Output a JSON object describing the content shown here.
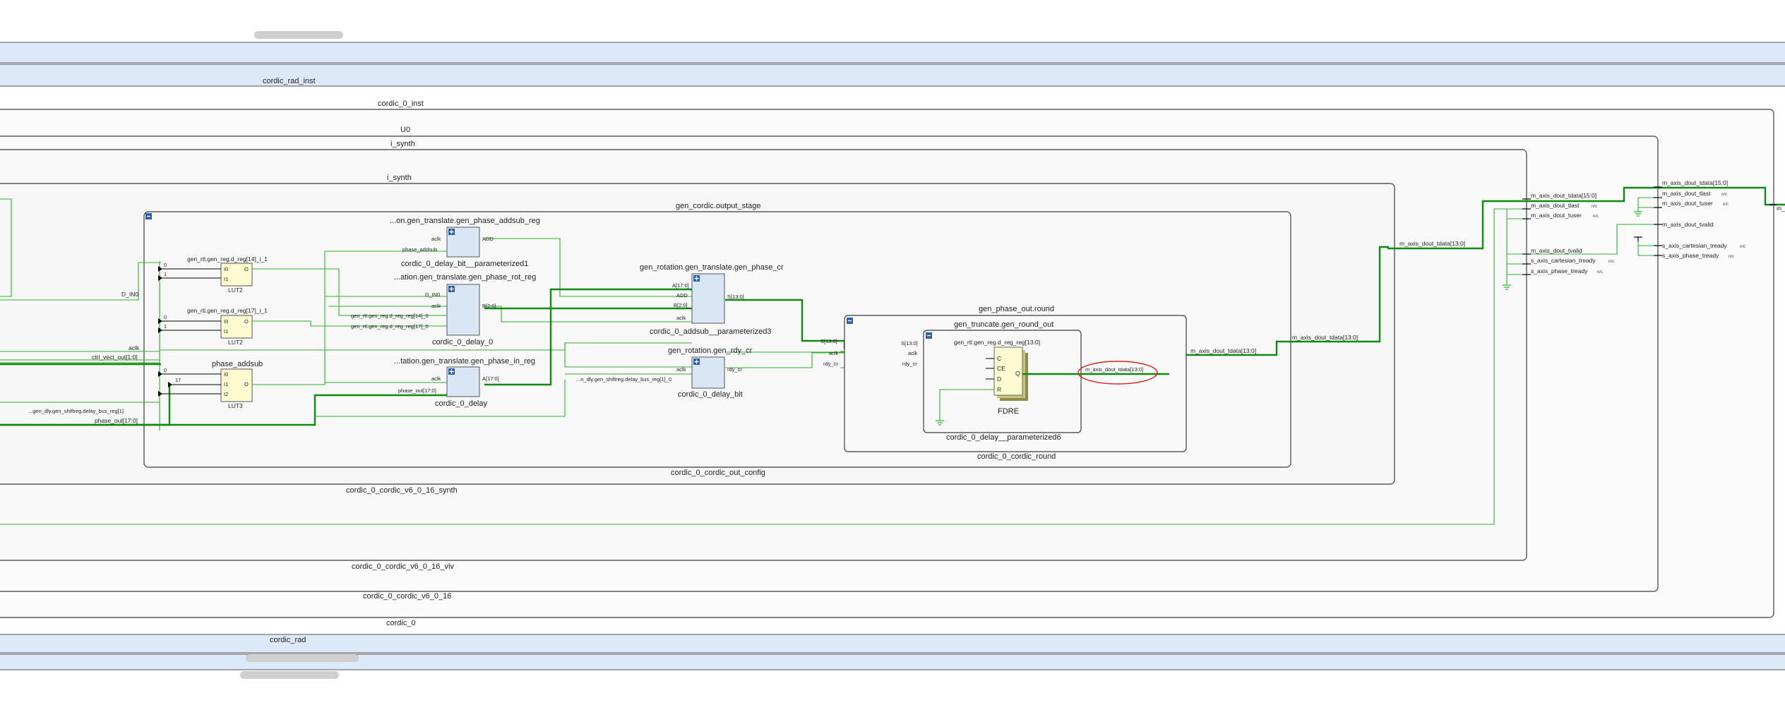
{
  "colors": {
    "wire": "#2fae2f",
    "wire_dark": "#108a10",
    "frame": "#3c3c3c",
    "bus": "#000000",
    "band_fill": "#dce9f8",
    "cell_blue": "#d9e6f6",
    "cell_yellow": "#fdfbcf",
    "annotation": "#e02020"
  },
  "bands": {
    "top_label": "cordic_rad_inst",
    "bottom_label": "cordic_rad"
  },
  "hierarchy": {
    "cordic_0_inst": "cordic_0_inst",
    "u0": "U0",
    "i_synth_outer": "i_synth",
    "i_synth_inner": "i_synth",
    "output_stage": "gen_cordic.output_stage",
    "cordic_0_bottom": "cordic_0",
    "cordic_v6_bottom": "cordic_0_cordic_v6_0_16",
    "viv_bottom": "cordic_0_cordic_v6_0_16_viv",
    "synth_bottom": "cordic_0_cordic_v6_0_16_synth",
    "out_config_bottom": "cordic_0_cordic_out_config",
    "phase_out_round": "gen_phase_out.round",
    "round_bottom": "cordic_0_cordic_round",
    "truncate": "gen_truncate.gen_round_out",
    "truncate_bottom": "cordic_0_delay__parameterized6"
  },
  "luts": [
    {
      "title": "gen_rtl.gen_reg.d_reg[14]_i_1",
      "type": "LUT2",
      "pins": [
        "I0",
        "I1"
      ],
      "out": "O"
    },
    {
      "title": "gen_rtl.gen_reg.d_reg[17]_i_1",
      "type": "LUT2",
      "pins": [
        "I0",
        "I1"
      ],
      "out": "O"
    },
    {
      "title": "phase_addsub",
      "type": "LUT3",
      "pins": [
        "I0",
        "I1",
        "I2"
      ],
      "out": "O"
    }
  ],
  "blocks": {
    "addsub_reg": {
      "title": "...on.gen_translate.gen_phase_addsub_reg",
      "pins": [
        "aclk",
        "phase_addsub"
      ],
      "out": "ADD",
      "bottom": "cordic_0_delay_bit__parameterized1"
    },
    "rot_reg": {
      "title": "...ation.gen_translate.gen_phase_rot_reg",
      "pins": [
        "D_IN0",
        "aclk",
        "gen_rtl.gen_reg.d_reg_reg[14]_0",
        "gen_rtl.gen_reg.d_reg_reg[17]_0"
      ],
      "out": "B[2:0]",
      "bottom": "cordic_0_delay_0"
    },
    "in_reg": {
      "title": "...tation.gen_translate.gen_phase_in_reg",
      "pins": [
        "aclk",
        "phase_out[17:0]"
      ],
      "out": "A[17:0]",
      "bottom": "cordic_0_delay"
    },
    "phase_cr": {
      "title": "gen_rotation.gen_translate.gen_phase_cr",
      "pins": [
        "A[17:0]",
        "ADD",
        "B[2:0]",
        "aclk"
      ],
      "out": "S[13:0]",
      "bottom": "cordic_0_addsub__parameterized3"
    },
    "rdy_cr": {
      "title": "gen_rotation.gen_rdy_cr",
      "pins": [
        "aclk",
        "...n_dly.gen_shiftreg.delay_bus_reg[1]_0"
      ],
      "out": "rdy_cr",
      "bottom": "cordic_0_delay_bit"
    }
  },
  "round_ports": {
    "s": "S[13:0]",
    "aclk": "aclk",
    "rdy": "rdy_cr"
  },
  "truncate_ports": {
    "s": "S[13:0]",
    "aclk": "aclk",
    "rdy": "rdy_cr"
  },
  "fdre": {
    "title": "gen_rtl.gen_reg.d_reg_reg[13:0]",
    "pins": [
      "C",
      "CE",
      "D",
      "R"
    ],
    "out": "Q",
    "type": "FDRE"
  },
  "nets": {
    "left": [
      "D_IN0",
      "aclk",
      "ctrl_vect_out[1:0]",
      "...gen_dly.gen_shiftreg.delay_bus_reg[1]",
      "phase_out[17:0]"
    ],
    "bit_labels": [
      "0",
      "1",
      "0",
      "1",
      "0",
      "17"
    ],
    "annotated": "m_axis_dout_tdata[13:0]",
    "round_out": "m_axis_dout_tdata[13:0]",
    "out_config_out": "m_axis_dout_tdata[13:0]",
    "synth_out": "m_axis_dout_tdata[13:0]"
  },
  "viv_ports": [
    {
      "label": "m_axis_dout_tdata[15:0]",
      "nc": ""
    },
    {
      "label": "m_axis_dout_tlast",
      "nc": "n/c"
    },
    {
      "label": "m_axis_dout_tuser",
      "nc": "n/c"
    },
    {
      "label": "m_axis_dout_tvalid",
      "nc": ""
    },
    {
      "label": "s_axis_cartesian_tready",
      "nc": "n/c"
    },
    {
      "label": "s_axis_phase_tready",
      "nc": "n/c"
    }
  ],
  "u0_ports": [
    {
      "label": "m_axis_dout_tdata[15:0]",
      "nc": ""
    },
    {
      "label": "m_axis_dout_tlast",
      "nc": "n/c"
    },
    {
      "label": "m_axis_dout_tuser",
      "nc": "n/c"
    },
    {
      "label": "m_axis_dout_tvalid",
      "nc": ""
    },
    {
      "label": "s_axis_cartesian_tready",
      "nc": "n/c"
    },
    {
      "label": "s_axis_phase_tready",
      "nc": "n/c"
    }
  ],
  "edge_label": "m_"
}
